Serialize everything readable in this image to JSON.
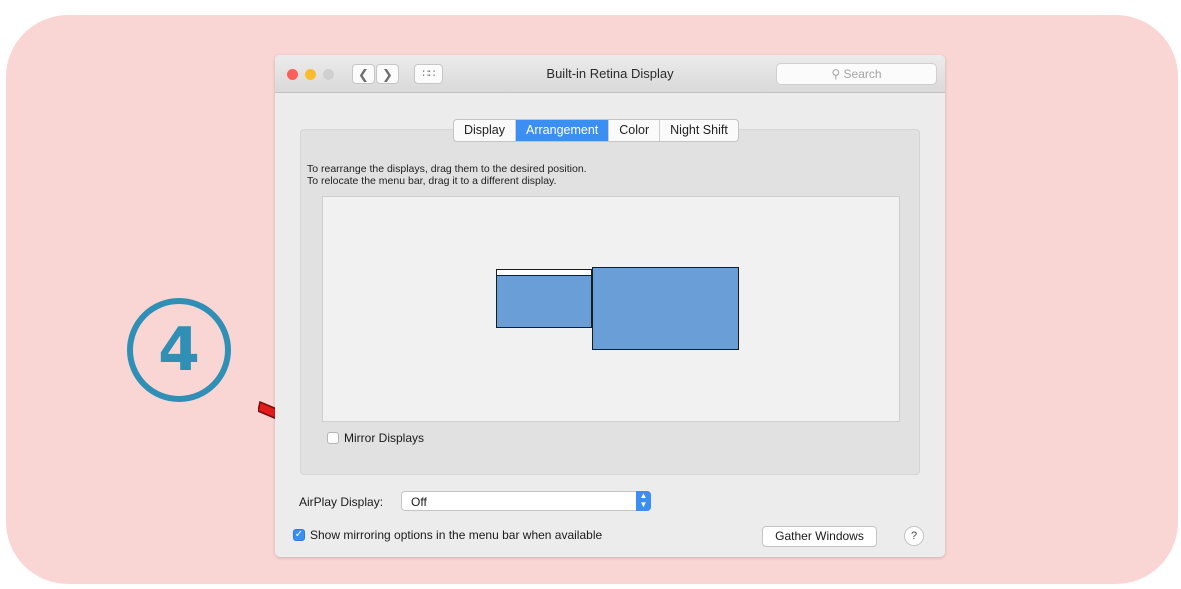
{
  "annotation": {
    "step_number": "4",
    "badge_color": "#2f8fb5",
    "arrow_color": "#e21b1b",
    "background_color": "#f9d6d4"
  },
  "window": {
    "title": "Built-in Retina Display",
    "search_placeholder": "Search",
    "nav_icons": [
      "chevron-left-icon",
      "chevron-right-icon",
      "grid-icon"
    ]
  },
  "tabs": [
    {
      "label": "Display",
      "active": false
    },
    {
      "label": "Arrangement",
      "active": true
    },
    {
      "label": "Color",
      "active": false
    },
    {
      "label": "Night Shift",
      "active": false
    }
  ],
  "arrangement": {
    "instruction_line1": "To rearrange the displays, drag them to the desired position.",
    "instruction_line2": "To relocate the menu bar, drag it to a different display.",
    "display_color": "#6a9ed6"
  },
  "mirror_displays": {
    "label": "Mirror Displays",
    "checked": false
  },
  "airplay": {
    "label": "AirPlay Display:",
    "value": "Off"
  },
  "show_mirroring": {
    "label": "Show mirroring options in the menu bar when available",
    "checked": true
  },
  "buttons": {
    "gather_windows": "Gather Windows",
    "help": "?"
  }
}
